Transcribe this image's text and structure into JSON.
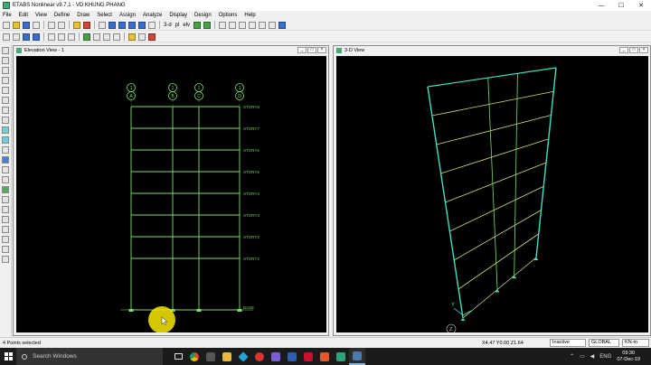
{
  "app": {
    "title": "ETABS Nonlinear v9.7.1 - VD KHUNG PHANG"
  },
  "window_controls": {
    "minimize": "—",
    "maximize": "☐",
    "close": "✕"
  },
  "menu": [
    "File",
    "Edit",
    "View",
    "Define",
    "Draw",
    "Select",
    "Assign",
    "Analyze",
    "Display",
    "Design",
    "Options",
    "Help"
  ],
  "toolbar": {
    "view_3d": "3-d",
    "pl": "pl",
    "elv": "elv",
    "zoom_icons": [
      "zoom-in-icon",
      "zoom-out-icon",
      "zoom-window-icon",
      "pan-icon",
      "restore-icon"
    ]
  },
  "elevation_view": {
    "title": "Elevation View - 1",
    "grid_bubbles": [
      {
        "top": "1",
        "bottom": "A"
      },
      {
        "top": "1",
        "bottom": "B"
      },
      {
        "top": "1",
        "bottom": "C"
      },
      {
        "top": "1",
        "bottom": "D"
      }
    ],
    "story_labels": [
      "STORY8",
      "STORY7",
      "STORY6",
      "STORY5",
      "STORY4",
      "STORY3",
      "STORY2",
      "STORY1",
      "BASE"
    ],
    "colors": {
      "frame": "#7ddf6a",
      "label": "#6fcf55",
      "highlight": "#f0e000"
    }
  },
  "view_3d": {
    "title": "3-D View",
    "axis_labels": {
      "y": "Y",
      "z": "Z"
    },
    "colors": {
      "frame": "#3fe0c8",
      "beam": "#d8e06a",
      "column": "#7ddf6a"
    }
  },
  "status": {
    "left": "4 Points selected",
    "coords": "X4.47  Y0.00  Z1.64",
    "mode": "Inactive",
    "csys": "GLOBAL",
    "units": "KN-m"
  },
  "taskbar": {
    "search_placeholder": "Search Windows",
    "lang": "ENG",
    "time": "09:30",
    "date": "07-Dec-19"
  }
}
